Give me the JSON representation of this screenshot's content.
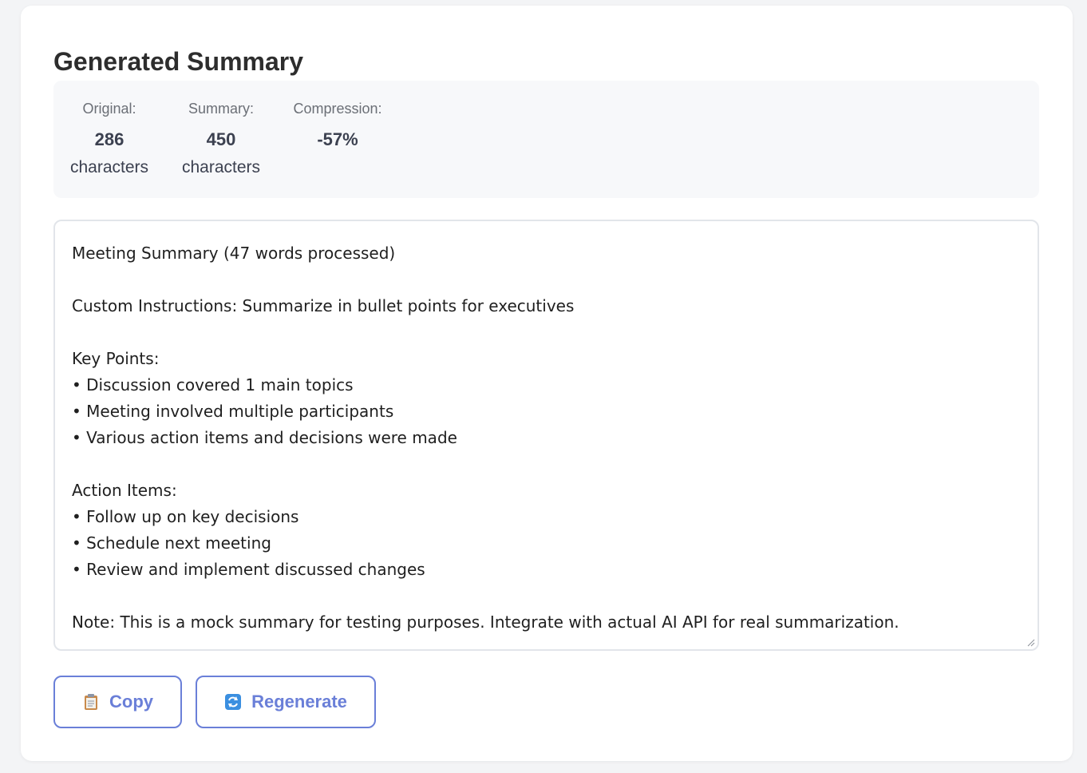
{
  "panel": {
    "title": "Generated Summary"
  },
  "stats": {
    "original": {
      "label": "Original:",
      "value": "286",
      "unit": "characters"
    },
    "summary": {
      "label": "Summary:",
      "value": "450",
      "unit": "characters"
    },
    "compression": {
      "label": "Compression:",
      "value": "-57%"
    }
  },
  "summary_text": "Meeting Summary (47 words processed)\n\nCustom Instructions: Summarize in bullet points for executives\n\nKey Points:\n• Discussion covered 1 main topics\n• Meeting involved multiple participants\n• Various action items and decisions were made\n\nAction Items:\n• Follow up on key decisions\n• Schedule next meeting\n• Review and implement discussed changes\n\nNote: This is a mock summary for testing purposes. Integrate with actual AI API for real summarization.",
  "buttons": {
    "copy": {
      "label": "Copy",
      "icon": "clipboard-icon"
    },
    "regenerate": {
      "label": "Regenerate",
      "icon": "refresh-icon"
    }
  },
  "colors": {
    "accent": "#6a7fd8",
    "stats_background": "#f7f8fa",
    "title": "#2d2d2d"
  }
}
